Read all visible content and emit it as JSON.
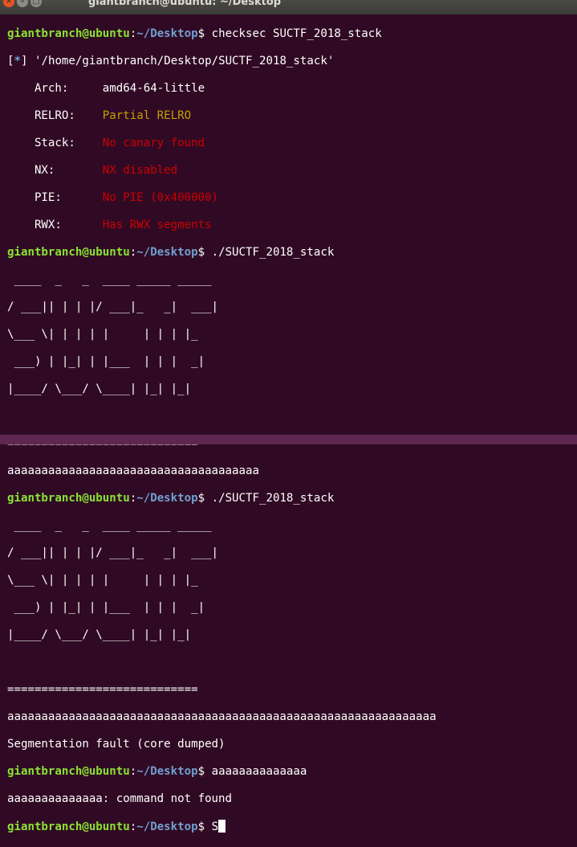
{
  "window": {
    "title": "giantbranch@ubuntu: ~/Desktop",
    "close_glyph": "×",
    "min_glyph": "–",
    "max_glyph": "□"
  },
  "prompt": {
    "user": "giantbranch@ubuntu",
    "sep": ":",
    "path": "~/Desktop",
    "sign": "$"
  },
  "cmd1": " checksec SUCTF_2018_stack",
  "checksec": {
    "header_bracket_open": "[",
    "header_star": "*",
    "header_bracket_close": "]",
    "header_text": " '/home/giantbranch/Desktop/SUCTF_2018_stack'",
    "arch_label": "    Arch:     ",
    "arch_value": "amd64-64-little",
    "relro_label": "    RELRO:    ",
    "relro_value": "Partial RELRO",
    "stack_label": "    Stack:    ",
    "stack_value": "No canary found",
    "nx_label": "    NX:       ",
    "nx_value": "NX disabled",
    "pie_label": "    PIE:      ",
    "pie_value": "No PIE (0x400000)",
    "rwx_label": "    RWX:      ",
    "rwx_value": "Has RWX segments"
  },
  "cmd2": " ./SUCTF_2018_stack",
  "banner": [
    " ____  _   _  ____ _____ _____",
    "/ ___|| | | |/ ___|_   _|  ___|",
    "\\___ \\| | | | |     | | | |_",
    " ___) | |_| | |___  | | |  _|",
    "|____/ \\___/ \\____| |_| |_|"
  ],
  "separator": "============================",
  "input1": "aaaaaaaaaaaaaaaaaaaaaaaaaaaaaaaaaaaaa",
  "cmd3": " ./SUCTF_2018_stack",
  "input2": "aaaaaaaaaaaaaaaaaaaaaaaaaaaaaaaaaaaaaaaaaaaaaaaaaaaaaaaaaaaaaaa",
  "segfault": "Segmentation fault (core dumped)",
  "cmd4": " aaaaaaaaaaaaaa",
  "notfound": "aaaaaaaaaaaaaa: command not found",
  "cmd5_typed": " S"
}
